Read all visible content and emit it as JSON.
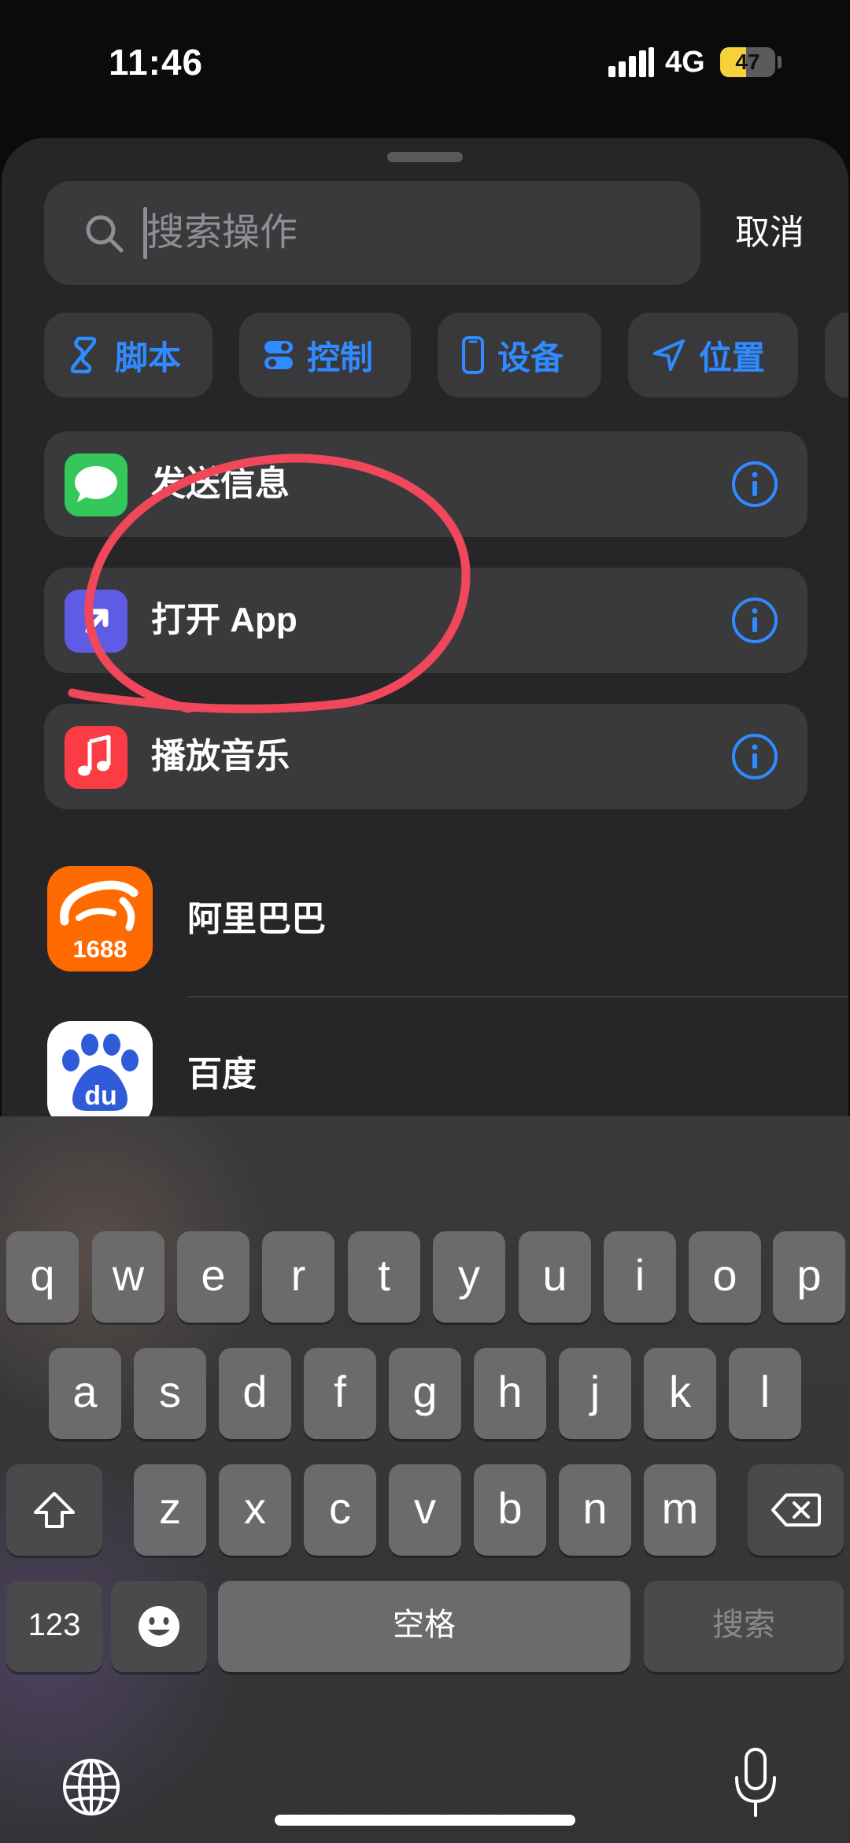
{
  "status_bar": {
    "time": "11:46",
    "network": "4G",
    "battery": "47",
    "battery_level": 0.47
  },
  "search": {
    "placeholder": "搜索操作",
    "cancel_label": "取消"
  },
  "categories": [
    {
      "label": "脚本",
      "icon": "script-icon"
    },
    {
      "label": "控制",
      "icon": "toggle-icon"
    },
    {
      "label": "设备",
      "icon": "phone-icon"
    },
    {
      "label": "位置",
      "icon": "location-arrow-icon"
    }
  ],
  "actions": [
    {
      "label": "发送信息",
      "icon": "messages-icon",
      "color": "#34c759"
    },
    {
      "label": "打开 App",
      "icon": "open-app-icon",
      "color": "#5e5ce6"
    },
    {
      "label": "播放音乐",
      "icon": "music-note-icon",
      "color": "#fc3c44"
    }
  ],
  "apps": [
    {
      "label": "阿里巴巴",
      "icon": "alibaba-1688-icon",
      "badge_text": "1688",
      "color": "#ff6a00"
    },
    {
      "label": "百度",
      "icon": "baidu-paw-icon",
      "badge_text": "du",
      "color": "#2f5bd8"
    }
  ],
  "keyboard": {
    "row1": [
      "q",
      "w",
      "e",
      "r",
      "t",
      "y",
      "u",
      "i",
      "o",
      "p"
    ],
    "row2": [
      "a",
      "s",
      "d",
      "f",
      "g",
      "h",
      "j",
      "k",
      "l"
    ],
    "row3": [
      "z",
      "x",
      "c",
      "v",
      "b",
      "n",
      "m"
    ],
    "numbers_label": "123",
    "space_label": "空格",
    "search_label": "搜索"
  },
  "colors": {
    "accent": "#2f8bff",
    "annotation": "#f0475a"
  }
}
